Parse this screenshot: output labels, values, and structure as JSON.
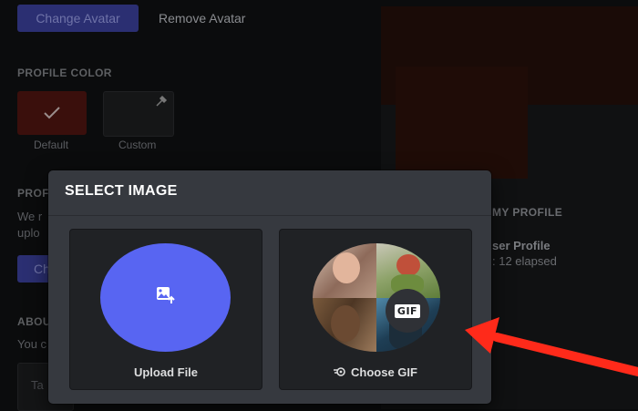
{
  "background": {
    "change_avatar": "Change Avatar",
    "remove_avatar": "Remove Avatar",
    "profile_color_label": "PROFILE COLOR",
    "swatch_default": "Default",
    "swatch_custom": "Custom",
    "section_fragment": "PROF",
    "line_fragment_1": "We r",
    "line_fragment_2": "uplo",
    "button_fragment": "Ch",
    "about_fragment": "ABOU",
    "about_text_fragment": "You c",
    "about_box_fragment": "Ta",
    "right_label": "MY PROFILE",
    "right_profile": "ser Profile",
    "right_elapsed": ": 12 elapsed"
  },
  "modal": {
    "title": "SELECT IMAGE",
    "upload_label": "Upload File",
    "gif_label": "Choose GIF",
    "gif_badge": "GIF"
  },
  "icons": {
    "upload": "image-upload-icon",
    "gif_search": "gif-search-icon",
    "check": "check-icon",
    "dropper": "eyedropper-icon"
  },
  "colors": {
    "modal_bg": "#36393f",
    "option_bg": "#202225",
    "upload_circle": "#5865f2",
    "arrow": "#ff2a1a",
    "primary_dim": "#2b2f72"
  }
}
